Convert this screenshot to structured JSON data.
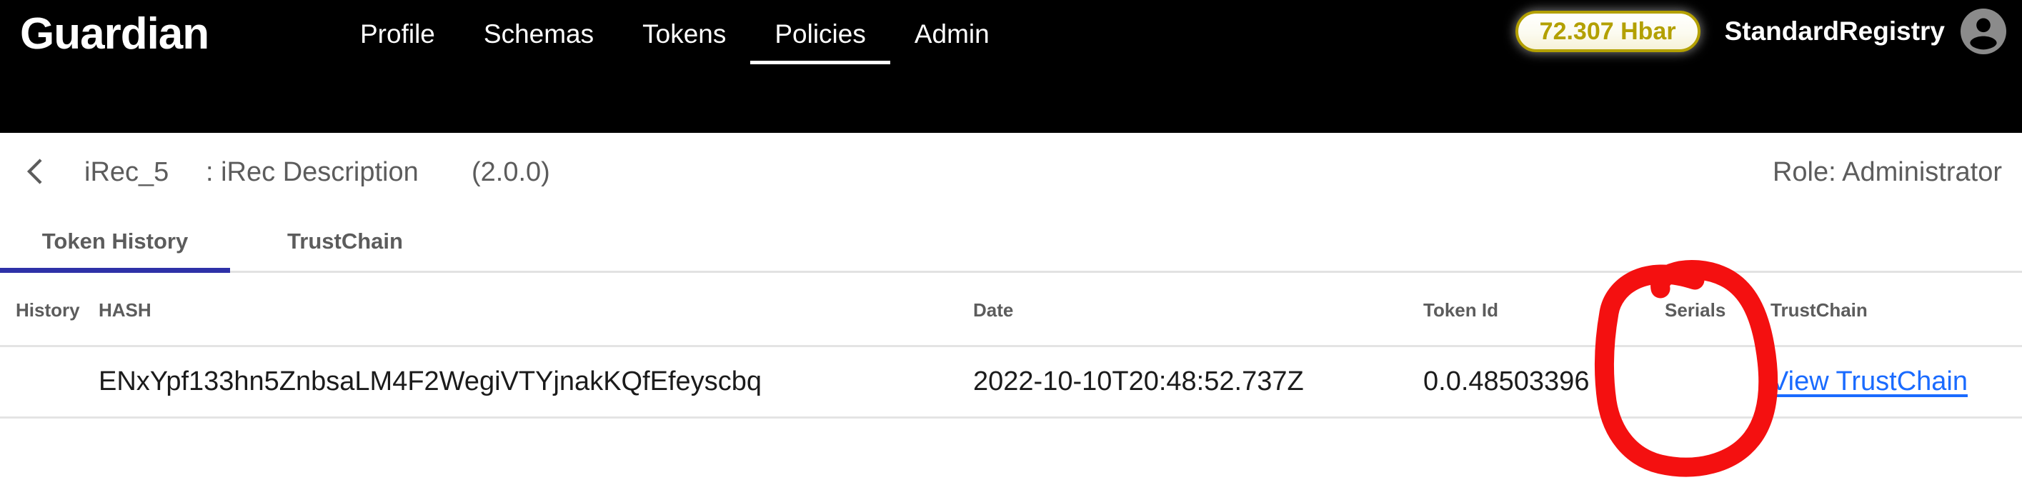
{
  "topnav": {
    "brand": "Guardian",
    "links": [
      {
        "label": "Profile",
        "active": false
      },
      {
        "label": "Schemas",
        "active": false
      },
      {
        "label": "Tokens",
        "active": false
      },
      {
        "label": "Policies",
        "active": true
      },
      {
        "label": "Admin",
        "active": false
      }
    ],
    "balance": "72.307 Hbar",
    "username": "StandardRegistry",
    "avatar_icon": "user-avatar-icon",
    "colors": {
      "background": "#000000",
      "text": "#ffffff",
      "balance_border": "#b3a000",
      "balance_text": "#b3a000",
      "active_underline": "#ffffff"
    }
  },
  "breadcrumb": {
    "back_icon": "chevron-left-icon",
    "policy_name": "iRec_5",
    "policy_description": ": iRec Description",
    "policy_version": "(2.0.0)",
    "role": "Role: Administrator"
  },
  "tabs": [
    {
      "label": "Token History",
      "active": true
    },
    {
      "label": "TrustChain",
      "active": false
    }
  ],
  "tabs_active_color": "#2e31a8",
  "table": {
    "columns": [
      "History",
      "HASH",
      "Date",
      "Token Id",
      "Serials",
      "TrustChain"
    ],
    "rows": [
      {
        "history": "",
        "hash": "ENxYpf133hn5ZnbsaLM4F2WegiVTYjnakKQfEfeyscbq",
        "date": "2022-10-10T20:48:52.737Z",
        "token_id": "0.0.48503396",
        "serials": "",
        "trustchain": "View TrustChain"
      }
    ],
    "link_color": "#1a6bff"
  },
  "annotation": {
    "shape": "hand-drawn-ellipse",
    "color": "#f41010",
    "target": "Serials column"
  }
}
